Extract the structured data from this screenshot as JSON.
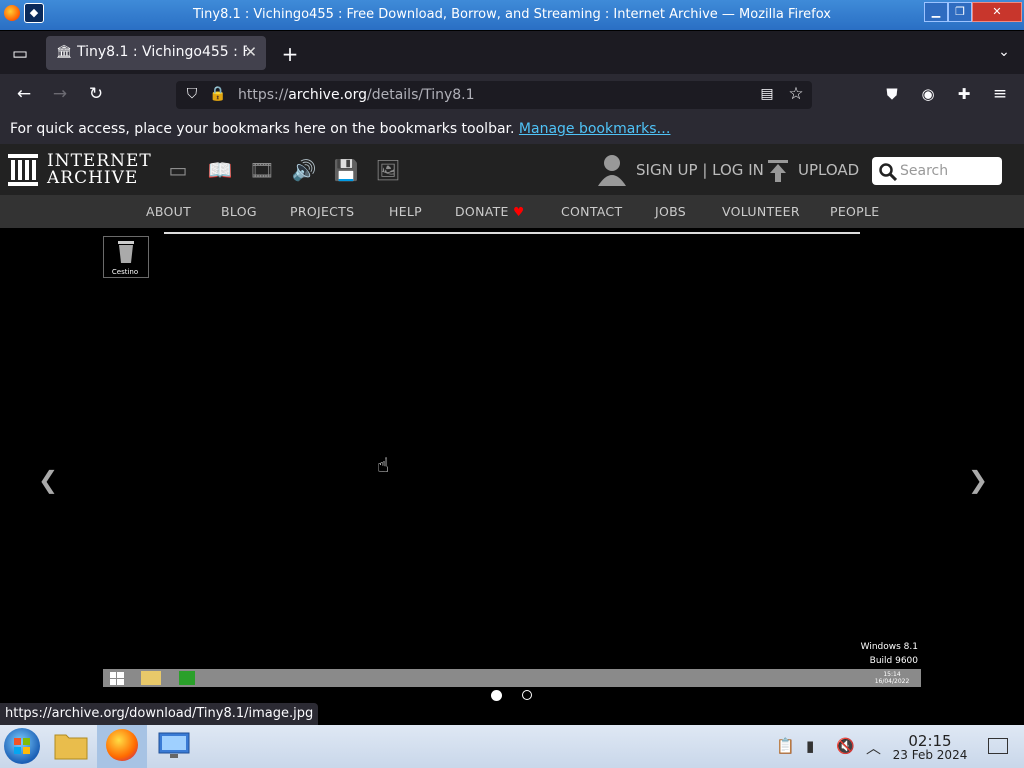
{
  "window": {
    "title": "Tiny8.1 : Vichingo455 : Free Download, Borrow, and Streaming : Internet Archive — Mozilla Firefox"
  },
  "tabs": [
    {
      "title": "Tiny8.1 : Vichingo455 : F",
      "icon": "archive-icon",
      "active": true
    }
  ],
  "navbar": {
    "url_prefix": "https://",
    "url_host": "archive.org",
    "url_path": "/details/Tiny8.1"
  },
  "bookmarks_bar": {
    "message": "For quick access, place your bookmarks here on the bookmarks toolbar.",
    "link": "Manage bookmarks…"
  },
  "ia_header": {
    "logo_line1": "INTERNET",
    "logo_line2": "ARCHIVE",
    "signup": "SIGN UP | LOG IN",
    "upload": "UPLOAD",
    "search_placeholder": "Search"
  },
  "ia_nav": [
    "ABOUT",
    "BLOG",
    "PROJECTS",
    "HELP",
    "DONATE",
    "CONTACT",
    "JOBS",
    "VOLUNTEER",
    "PEOPLE"
  ],
  "screenshot": {
    "desktop_icon_label": "Cestino",
    "watermark_line1": "Windows 8.1",
    "watermark_line2": "Build 9600",
    "clock_time": "15:14",
    "clock_date": "16/04/2022"
  },
  "carousel": {
    "slide_count": 2,
    "active_slide": 1
  },
  "status_url": "https://archive.org/download/Tiny8.1/image.jpg",
  "os_taskbar": {
    "time": "02:15",
    "date": "23 Feb 2024"
  },
  "colors": {
    "firefox_dark": "#1c1b22",
    "firefox_toolbar": "#2b2a33",
    "ia_header": "#222222",
    "ia_nav": "#333333",
    "link": "#4fc3f7",
    "donate_heart": "#ff0000"
  }
}
